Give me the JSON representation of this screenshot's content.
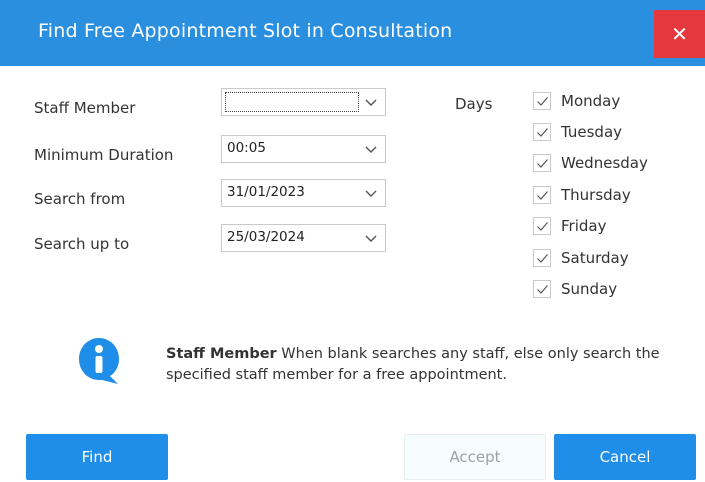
{
  "window": {
    "title": "Find Free Appointment Slot in Consultation",
    "close_label": "✕"
  },
  "form": {
    "staff_member": {
      "label": "Staff Member",
      "value": ""
    },
    "minimum_duration": {
      "label": "Minimum Duration",
      "value": "00:05"
    },
    "search_from": {
      "label": "Search from",
      "value": "31/01/2023"
    },
    "search_up_to": {
      "label": "Search up to",
      "value": "25/03/2024"
    }
  },
  "days": {
    "label": "Days",
    "items": [
      {
        "label": "Monday",
        "checked": true
      },
      {
        "label": "Tuesday",
        "checked": true
      },
      {
        "label": "Wednesday",
        "checked": true
      },
      {
        "label": "Thursday",
        "checked": true
      },
      {
        "label": "Friday",
        "checked": true
      },
      {
        "label": "Saturday",
        "checked": true
      },
      {
        "label": "Sunday",
        "checked": true
      }
    ]
  },
  "info": {
    "title": "Staff Member",
    "text": " When blank searches any staff, else only search the specified staff member for a free appointment."
  },
  "buttons": {
    "find": "Find",
    "accept": "Accept",
    "cancel": "Cancel"
  },
  "colors": {
    "titlebar": "#2b8fe0",
    "close": "#e5393f",
    "primary": "#1f8ee8"
  }
}
